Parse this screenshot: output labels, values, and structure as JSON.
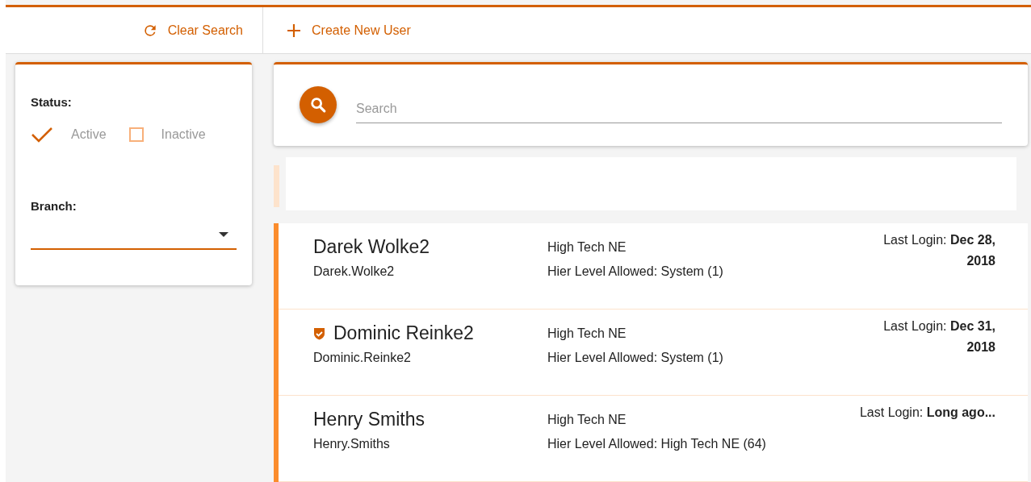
{
  "toolbar": {
    "clear_search": {
      "label": "Clear Search"
    },
    "create_user": {
      "label": "Create New User"
    }
  },
  "filters": {
    "status_label": "Status:",
    "statuses": [
      {
        "label": "Active",
        "checked": true
      },
      {
        "label": "Inactive",
        "checked": false
      }
    ],
    "branch_label": "Branch:"
  },
  "search": {
    "placeholder": "Search"
  },
  "users": [
    {
      "name": "Darek Wolke2",
      "username": "Darek.Wolke2",
      "verified": false,
      "branch": "High Tech NE",
      "hier_level": "Hier Level Allowed: System (1)",
      "last_login": "Last Login: **Dec 28, 2018**"
    },
    {
      "name": "Dominic Reinke2",
      "username": "Dominic.Reinke2",
      "verified": true,
      "branch": "High Tech NE",
      "hier_level": "Hier Level Allowed: System (1)",
      "last_login": "Last Login: **Dec 31, 2018**"
    },
    {
      "name": "Henry Smiths",
      "username": "Henry.Smiths",
      "verified": false,
      "branch": "High Tech NE",
      "hier_level": "Hier Level Allowed: High Tech NE (64)",
      "last_login": "Last Login: **Long ago...**"
    }
  ]
}
